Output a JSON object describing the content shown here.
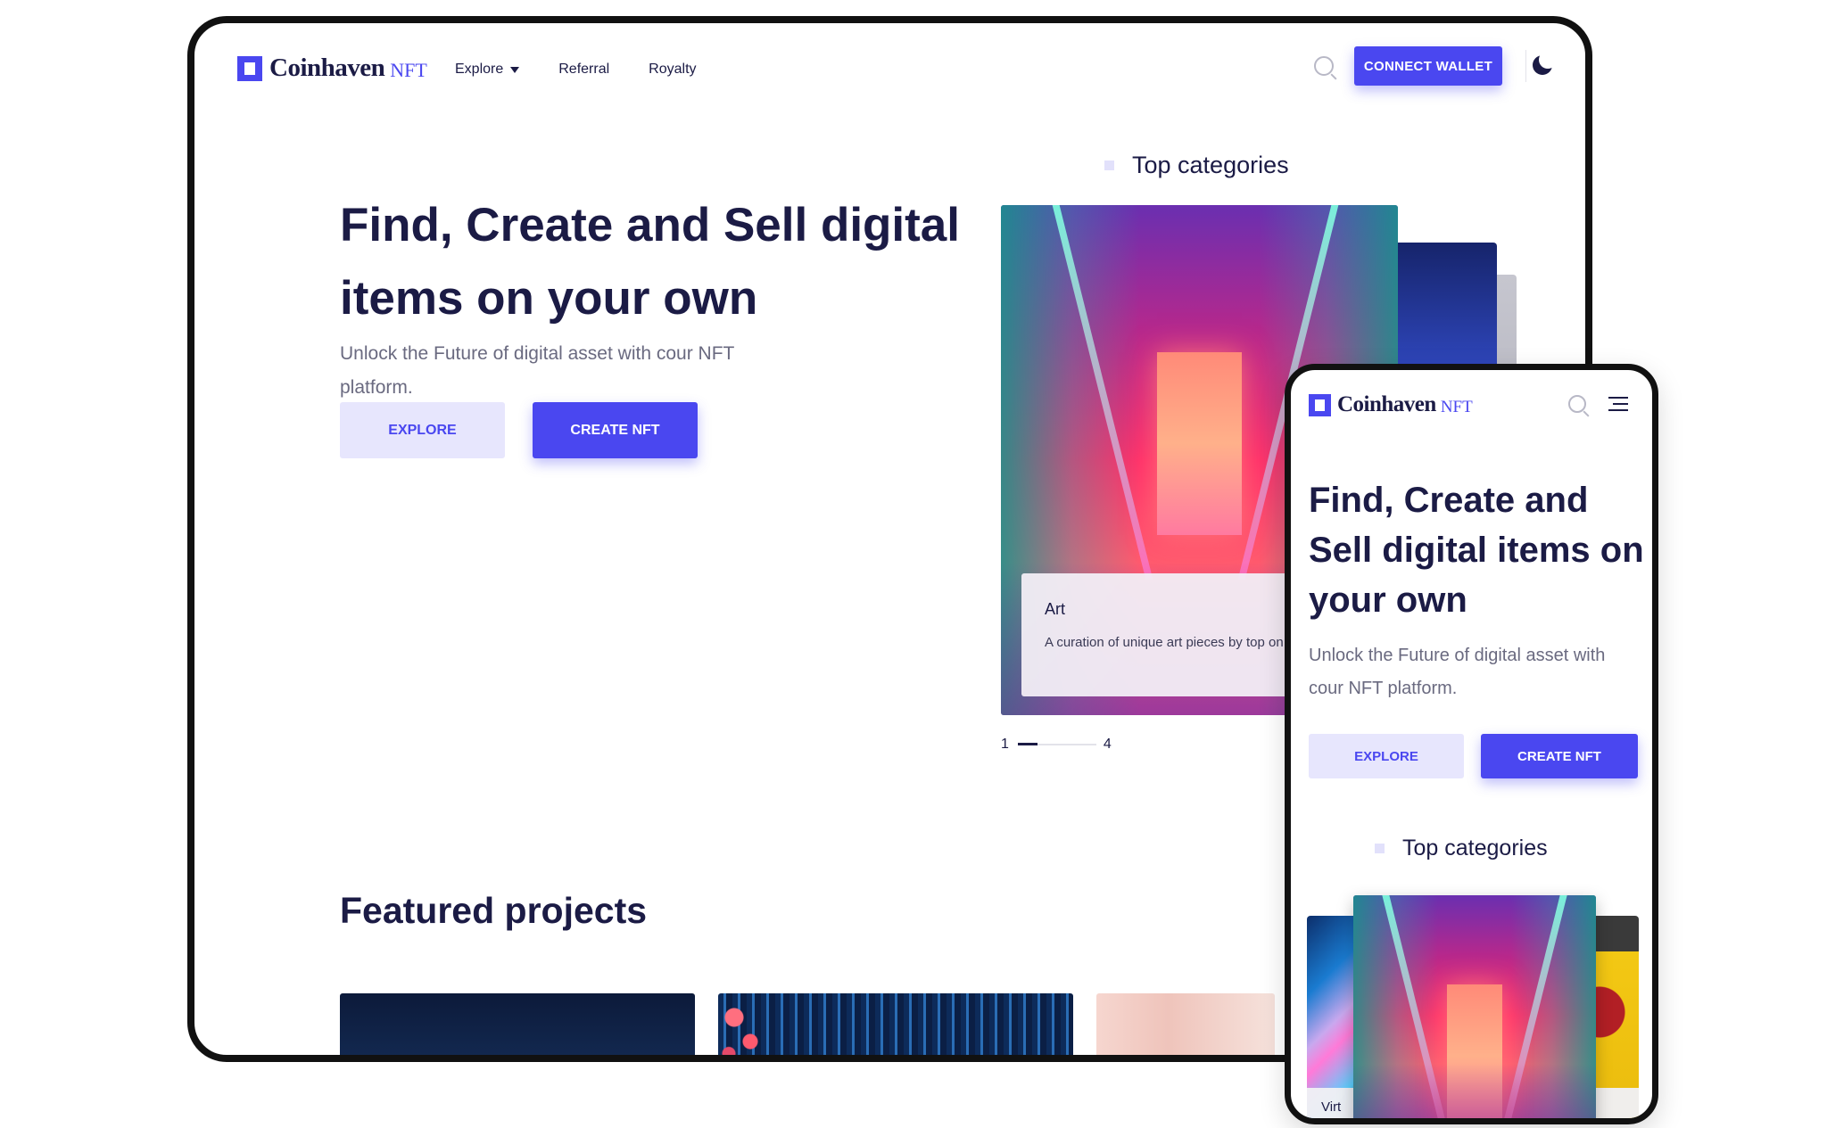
{
  "brand": {
    "name": "Coinhaven",
    "suffix": "NFT",
    "accent": "#4a47f0",
    "text": "#1b1b45"
  },
  "desktop": {
    "nav": {
      "explore": "Explore",
      "referral": "Referral",
      "royalty": "Royalty"
    },
    "connect_wallet": "CONNECT WALLET",
    "hero": {
      "title": "Find, Create and Sell digital items on your own",
      "subtitle": "Unlock the Future of digital asset with cour NFT platform.",
      "explore_btn": "EXPLORE",
      "create_btn": "CREATE NFT"
    },
    "top_categories": {
      "heading": "Top categories",
      "card": {
        "title": "Art",
        "description": "A curation of unique art pieces by top on Coinhaven"
      },
      "pager": {
        "current": "1",
        "total": "4"
      }
    },
    "featured": {
      "heading": "Featured projects"
    }
  },
  "mobile": {
    "hero": {
      "title": "Find, Create and Sell digital items on your own",
      "subtitle": "Unlock the Future of digital asset with cour NFT platform.",
      "explore_btn": "EXPLORE",
      "create_btn": "CREATE NFT"
    },
    "top_categories": {
      "heading": "Top categories",
      "side_card_label": "Virt"
    }
  },
  "icons": [
    "logo-icon",
    "chevron-down-icon",
    "search-icon",
    "moon-icon",
    "menu-icon"
  ]
}
